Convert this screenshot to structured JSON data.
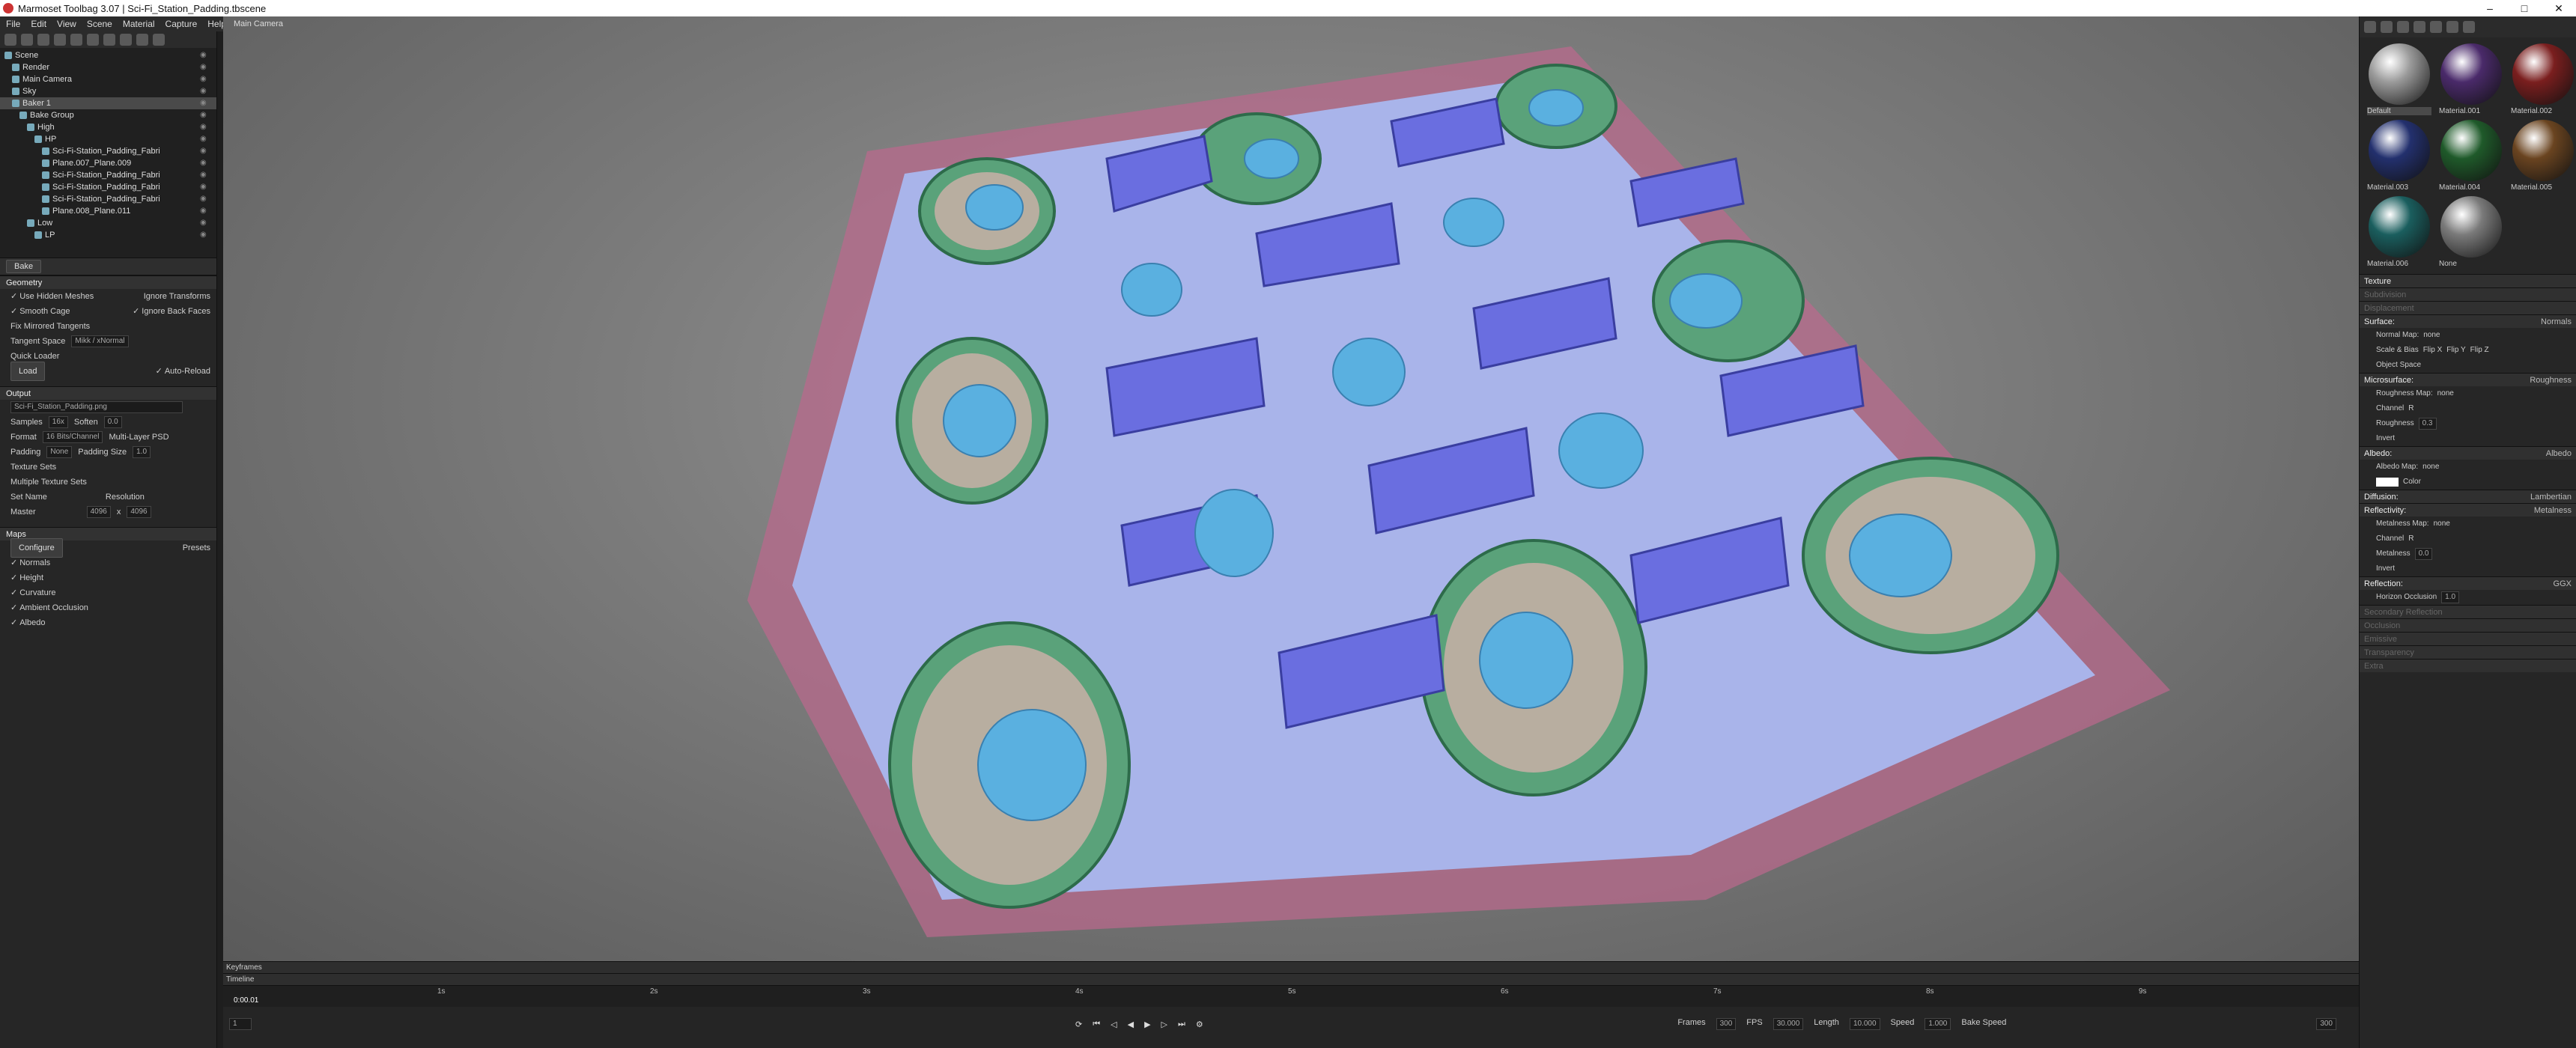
{
  "window": {
    "title": "Marmoset Toolbag 3.07  |  Sci-Fi_Station_Padding.tbscene"
  },
  "menu": [
    "File",
    "Edit",
    "View",
    "Scene",
    "Material",
    "Capture",
    "Help"
  ],
  "scene_tree": [
    {
      "label": "Scene",
      "indent": 0
    },
    {
      "label": "Render",
      "indent": 1
    },
    {
      "label": "Main Camera",
      "indent": 1
    },
    {
      "label": "Sky",
      "indent": 1
    },
    {
      "label": "Baker 1",
      "indent": 1,
      "selected": true
    },
    {
      "label": "Bake Group",
      "indent": 2
    },
    {
      "label": "High",
      "indent": 3
    },
    {
      "label": "HP",
      "indent": 4
    },
    {
      "label": "Sci-Fi-Station_Padding_Fabri",
      "indent": 5
    },
    {
      "label": "Plane.007_Plane.009",
      "indent": 5
    },
    {
      "label": "Sci-Fi-Station_Padding_Fabri",
      "indent": 5
    },
    {
      "label": "Sci-Fi-Station_Padding_Fabri",
      "indent": 5
    },
    {
      "label": "Sci-Fi-Station_Padding_Fabri",
      "indent": 5
    },
    {
      "label": "Plane.008_Plane.011",
      "indent": 5
    },
    {
      "label": "Low",
      "indent": 3
    },
    {
      "label": "LP",
      "indent": 4
    }
  ],
  "bake": {
    "button": "Bake"
  },
  "geometry": {
    "header": "Geometry",
    "use_hidden": "Use Hidden Meshes",
    "ignore_transforms": "Ignore Transforms",
    "smooth_cage": "Smooth Cage",
    "ignore_back": "Ignore Back Faces",
    "fix_mirrored": "Fix Mirrored Tangents",
    "tangent_label": "Tangent Space",
    "tangent_value": "Mikk / xNormal",
    "quick_loader": "Quick Loader",
    "load": "Load",
    "auto_reload": "Auto-Reload"
  },
  "output": {
    "header": "Output",
    "file": "Sci-Fi_Station_Padding.png",
    "samples_label": "Samples",
    "samples": "16x",
    "soften_label": "Soften",
    "soften": "0.0",
    "format_label": "Format",
    "format": "16 Bits/Channel",
    "multi_layer": "Multi-Layer PSD",
    "padding_label": "Padding",
    "padding": "None",
    "padding_size_label": "Padding Size",
    "padding_size": "1.0",
    "texture_sets": "Texture Sets",
    "multiple": "Multiple Texture Sets",
    "set_name": "Set Name",
    "resolution": "Resolution",
    "master": "Master",
    "res_w": "4096",
    "res_h": "4096"
  },
  "maps": {
    "header": "Maps",
    "configure": "Configure",
    "presets": "Presets",
    "items": [
      "Normals",
      "Height",
      "Curvature",
      "Ambient Occlusion",
      "Albedo"
    ]
  },
  "viewport": {
    "camera": "Main Camera"
  },
  "materials": [
    {
      "name": "Default",
      "color": "#9a9a9a",
      "selected": true
    },
    {
      "name": "Material.001",
      "color": "#4a2a6a"
    },
    {
      "name": "Material.002",
      "color": "#7a1e1e"
    },
    {
      "name": "Material.003",
      "color": "#23306e"
    },
    {
      "name": "Material.004",
      "color": "#1f5a2a"
    },
    {
      "name": "Material.005",
      "color": "#6a4420"
    },
    {
      "name": "Material.006",
      "color": "#1a5e5e"
    },
    {
      "name": "None",
      "color": "#7a7a7a"
    }
  ],
  "props": {
    "texture": "Texture",
    "subdivision": "Subdivision",
    "displacement": "Displacement",
    "surface": "Surface:",
    "surface_val": "Normals",
    "normal_map": "Normal Map:",
    "none": "none",
    "scale_bias": "Scale & Bias",
    "flip_x": "Flip X",
    "flip_y": "Flip Y",
    "flip_z": "Flip Z",
    "object_space": "Object Space",
    "microsurface": "Microsurface:",
    "micro_val": "Roughness",
    "roughness_map": "Roughness Map:",
    "channel": "Channel",
    "channel_val": "R",
    "roughness": "Roughness",
    "roughness_val": "0.3",
    "invert": "Invert",
    "albedo": "Albedo:",
    "albedo_val": "Albedo",
    "albedo_map": "Albedo Map:",
    "color": "Color",
    "diffusion": "Diffusion:",
    "diffusion_val": "Lambertian",
    "reflectivity": "Reflectivity:",
    "reflect_val": "Metalness",
    "metal_map": "Metalness Map:",
    "metalness": "Metalness",
    "metal_val": "0.0",
    "reflection": "Reflection:",
    "reflection_val": "GGX",
    "horizon": "Horizon Occlusion",
    "horizon_val": "1.0",
    "secondary": "Secondary Reflection",
    "occlusion": "Occlusion",
    "emissive": "Emissive",
    "transparency": "Transparency",
    "extra": "Extra"
  },
  "timeline": {
    "keyframes": "Keyframes",
    "timeline": "Timeline",
    "time": "0:00.01",
    "frame": "1",
    "ticks": [
      "1s",
      "2s",
      "3s",
      "4s",
      "5s",
      "6s",
      "7s",
      "8s",
      "9s"
    ],
    "frames_label": "Frames",
    "frames": "300",
    "fps_label": "FPS",
    "fps": "30.000",
    "length_label": "Length",
    "length": "10.000",
    "speed_label": "Speed",
    "speed": "1.000",
    "bake_speed": "Bake Speed",
    "end": "300"
  }
}
